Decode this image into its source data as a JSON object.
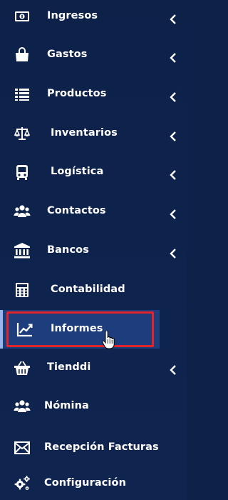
{
  "sidebar": {
    "items": [
      {
        "label": "Ingresos",
        "icon": "money-icon",
        "has_submenu": true
      },
      {
        "label": "Gastos",
        "icon": "shopping-bag-icon",
        "has_submenu": true
      },
      {
        "label": "Productos",
        "icon": "list-icon",
        "has_submenu": true
      },
      {
        "label": "Inventarios",
        "icon": "balance-scale-icon",
        "has_submenu": true
      },
      {
        "label": "Logística",
        "icon": "truck-icon",
        "has_submenu": true
      },
      {
        "label": "Contactos",
        "icon": "users-icon",
        "has_submenu": true
      },
      {
        "label": "Bancos",
        "icon": "bank-icon",
        "has_submenu": true
      },
      {
        "label": "Contabilidad",
        "icon": "calculator-icon",
        "has_submenu": false
      },
      {
        "label": "Informes",
        "icon": "chart-line-icon",
        "has_submenu": false,
        "active": true
      },
      {
        "label": "Tienddi",
        "icon": "shopping-basket-icon",
        "has_submenu": true
      },
      {
        "label": "Nómina",
        "icon": "users-icon",
        "has_submenu": false
      },
      {
        "label": "Recepción Facturas",
        "icon": "envelope-icon",
        "has_submenu": false
      },
      {
        "label": "Configuración",
        "icon": "cogs-icon",
        "has_submenu": false
      }
    ]
  },
  "colors": {
    "background": "#0d2149",
    "active_background": "#1e3d7c",
    "highlight_border": "#e0242b",
    "text": "#ffffff"
  }
}
